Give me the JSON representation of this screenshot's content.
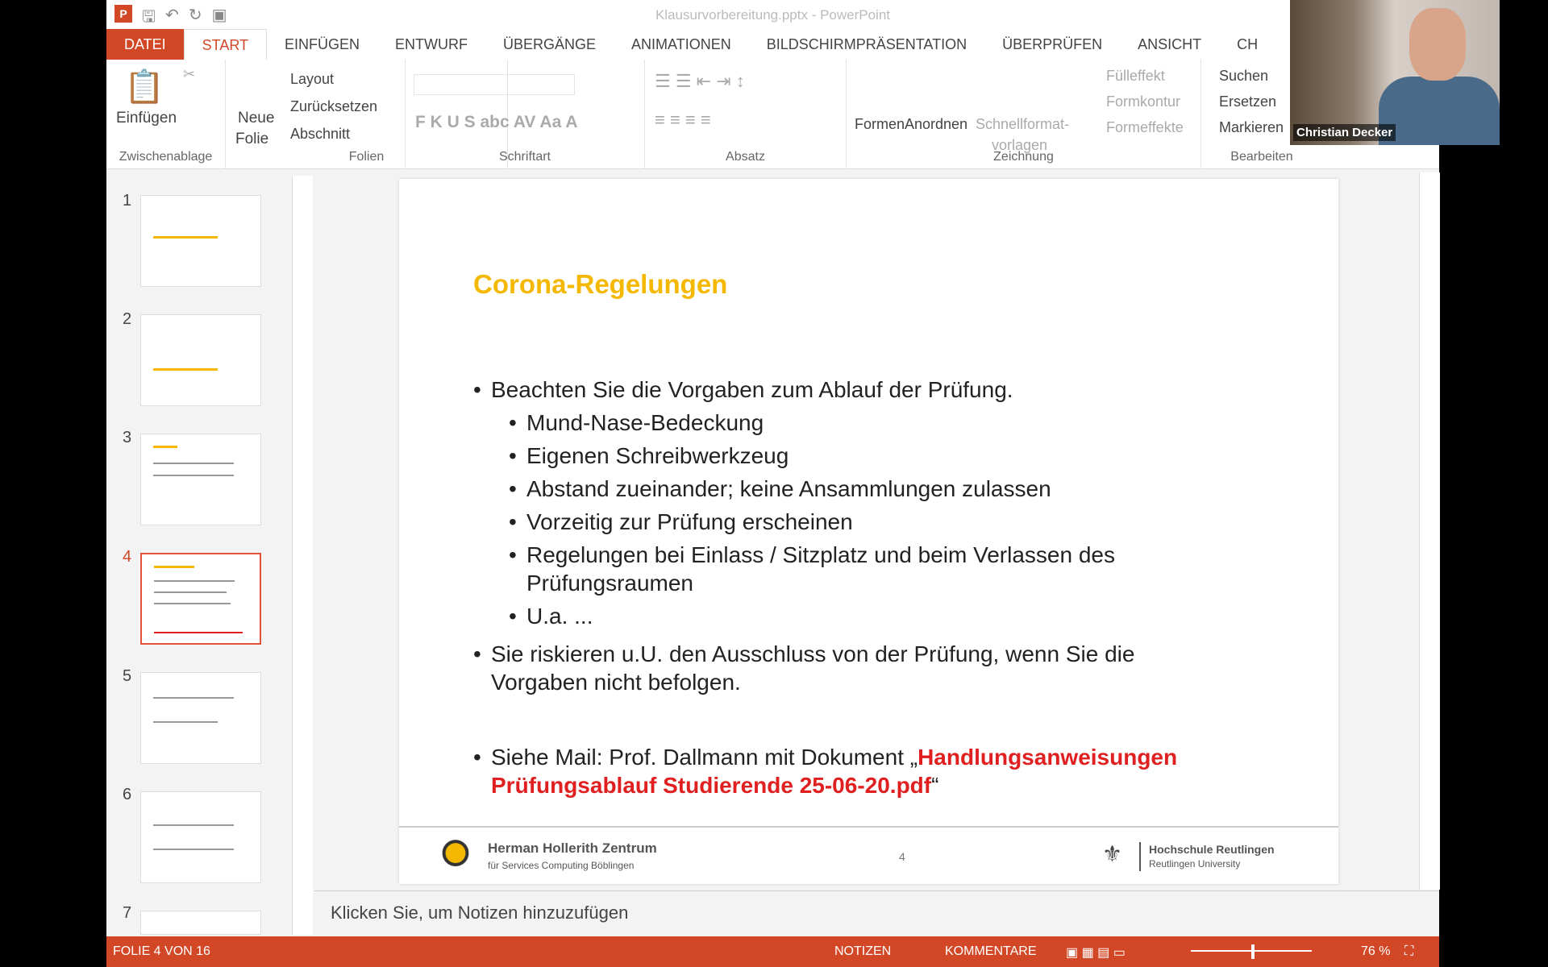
{
  "window": {
    "title": "Klausurvorbereitung.pptx - PowerPoint"
  },
  "tabs": [
    "DATEI",
    "START",
    "EINFÜGEN",
    "ENTWURF",
    "ÜBERGÄNGE",
    "ANIMATIONEN",
    "BILDSCHIRMPRÄSENTATION",
    "ÜBERPRÜFEN",
    "ANSICHT",
    "CH"
  ],
  "ribbon": {
    "clipboard": {
      "label": "Zwischenablage",
      "paste": "Einfügen"
    },
    "slides": {
      "label": "Folien",
      "new1": "Neue",
      "new2": "Folie",
      "layout": "Layout",
      "reset": "Zurücksetzen",
      "section": "Abschnitt"
    },
    "font": {
      "label": "Schriftart",
      "buttons": "F  K  U  S  abc  AV  Aa  A"
    },
    "paragraph": {
      "label": "Absatz"
    },
    "drawing": {
      "label": "Zeichnung",
      "shapes": "Formen",
      "arrange": "Anordnen",
      "quick1": "Schnellformat-",
      "quick2": "vorlagen",
      "fill": "Fülleffekt",
      "outline": "Formkontur",
      "effects": "Formeffekte"
    },
    "editing": {
      "label": "Bearbeiten",
      "find": "Suchen",
      "replace": "Ersetzen",
      "select": "Markieren"
    }
  },
  "thumbnails": [
    "1",
    "2",
    "3",
    "4",
    "5",
    "6",
    "7"
  ],
  "slide": {
    "title": "Corona-Regelungen",
    "b1": "Beachten Sie die Vorgaben zum Ablauf der Prüfung.",
    "sub": [
      "Mund-Nase-Bedeckung",
      "Eigenen Schreibwerkzeug",
      "Abstand zueinander; keine Ansammlungen zulassen",
      "Vorzeitig zur Prüfung erscheinen",
      "Regelungen bei Einlass / Sitzplatz und beim Verlassen des Prüfungsraumen",
      "U.a. ..."
    ],
    "b2": "Sie riskieren u.U. den Ausschluss von der Prüfung, wenn Sie die Vorgaben nicht befolgen.",
    "b3_pre": "Siehe Mail: Prof. Dallmann mit Dokument „",
    "b3_red": "Handlungsanweisungen Prüfungsablauf Studierende 25-06-20.pdf",
    "b3_post": "“",
    "footer": {
      "org1": "Herman Hollerith Zentrum",
      "org2": "für Services Computing Böblingen",
      "page": "4",
      "uni1": "Hochschule Reutlingen",
      "uni2": "Reutlingen University"
    }
  },
  "notes": "Klicken Sie, um Notizen hinzuzufügen",
  "status": {
    "slide": "FOLIE 4 VON 16",
    "notes": "NOTIZEN",
    "comments": "KOMMENTARE",
    "zoom": "76 %"
  },
  "webcam": {
    "name": "Christian Decker"
  },
  "colors": {
    "accent": "#d24726",
    "title": "#f5b800",
    "link": "#e02020"
  }
}
